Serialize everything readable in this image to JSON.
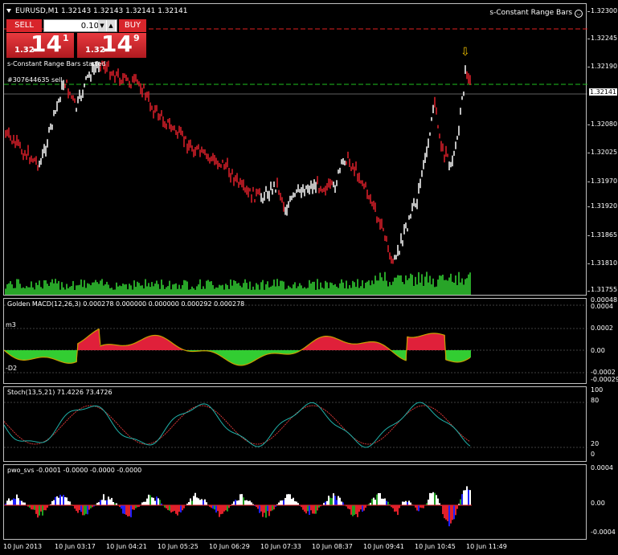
{
  "header": {
    "symbol_info": "EURUSD,M1  1.32143 1.32143 1.32141 1.32141",
    "ea_name": "s-Constant Range Bars"
  },
  "trade_panel": {
    "sell_label": "SELL",
    "buy_label": "BUY",
    "lot_value": "0.10",
    "spin_up": "▲",
    "spin_down": "▼",
    "sell_prefix": "1.32",
    "sell_big": "14",
    "sell_sup": "1",
    "buy_prefix": "1.32",
    "buy_big": "14",
    "buy_sup": "9"
  },
  "notices": {
    "started": "s-Constant Range Bars started",
    "order": "#307644635 sell"
  },
  "arrow_glyph": "⇩",
  "price_axis": [
    "1.32300",
    "1.32245",
    "1.32190",
    "1.32141",
    "1.32080",
    "1.32025",
    "1.31970",
    "1.31920",
    "1.31865",
    "1.31810",
    "1.31755"
  ],
  "macd": {
    "title": "Golden MACD(12,26,3) 0.000278 0.000000 0.000000 0.000292 0.000278",
    "levels": [
      "0.00048",
      "0.0004",
      "0.0002",
      "0.00",
      "-0.0002",
      "-0.00029"
    ],
    "m3": "m3",
    "d2": "-D2"
  },
  "stoch": {
    "title": "Stoch(13,5,21) 71.4226 73.4726",
    "levels": [
      "100",
      "80",
      "20",
      "0"
    ]
  },
  "pwo": {
    "title": "pwo_svs -0.0001 -0.0000 -0.0000 -0.0000",
    "levels": [
      "0.0004",
      "0.00",
      "-0.0004"
    ]
  },
  "time_axis": [
    "10 Jun 2013",
    "10 Jun 03:17",
    "10 Jun 04:21",
    "10 Jun 05:25",
    "10 Jun 06:29",
    "10 Jun 07:33",
    "10 Jun 08:37",
    "10 Jun 09:41",
    "10 Jun 10:45",
    "10 Jun 11:49"
  ],
  "colors": {
    "bull": "#ffffff",
    "bear": "#e0202a",
    "volume": "#32cd32",
    "macd_pos": "#e0203a",
    "macd_neg": "#32cd32",
    "signal": "#c8a000",
    "stoch_main": "#20b2aa",
    "stoch_signal": "#ff4040",
    "ask_line": "#e02020",
    "order_line": "#20c020"
  }
}
